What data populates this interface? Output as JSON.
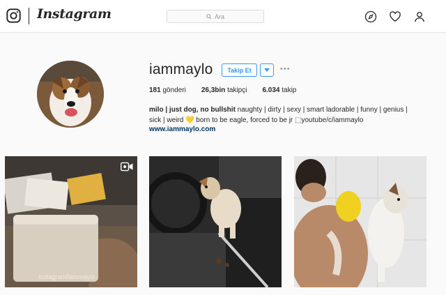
{
  "header": {
    "brand": "Instagram",
    "search_placeholder": "Ara"
  },
  "profile": {
    "username": "iammaylo",
    "follow_label": "Takip Et",
    "more_label": "•••",
    "stats": {
      "posts_count": "181",
      "posts_label": "gönderi",
      "followers_count": "26,3bin",
      "followers_label": "takipçi",
      "following_count": "6.034",
      "following_label": "takip"
    },
    "bio_bold": "milo | just dog, no bullshit",
    "bio_line1_rest": " naughty | dirty | sexy | smart ladorable | funny | genius |",
    "bio_line2": "sick | weird 💛 born to be eagle, forced to be jr ⬚youtube/c/iammaylo",
    "website": "www.iammaylo.com"
  },
  "posts": [
    {
      "watermark": "Instagram/iammaylo",
      "type": "video"
    },
    {
      "type": "photo"
    },
    {
      "type": "photo"
    }
  ],
  "icons": [
    "instagram-camera-icon",
    "search-icon",
    "compass-icon",
    "heart-icon",
    "profile-icon",
    "chevron-down-icon",
    "video-icon"
  ],
  "colors": {
    "accent": "#3897f0",
    "text": "#262626",
    "link": "#003569",
    "background": "#fafafa"
  }
}
